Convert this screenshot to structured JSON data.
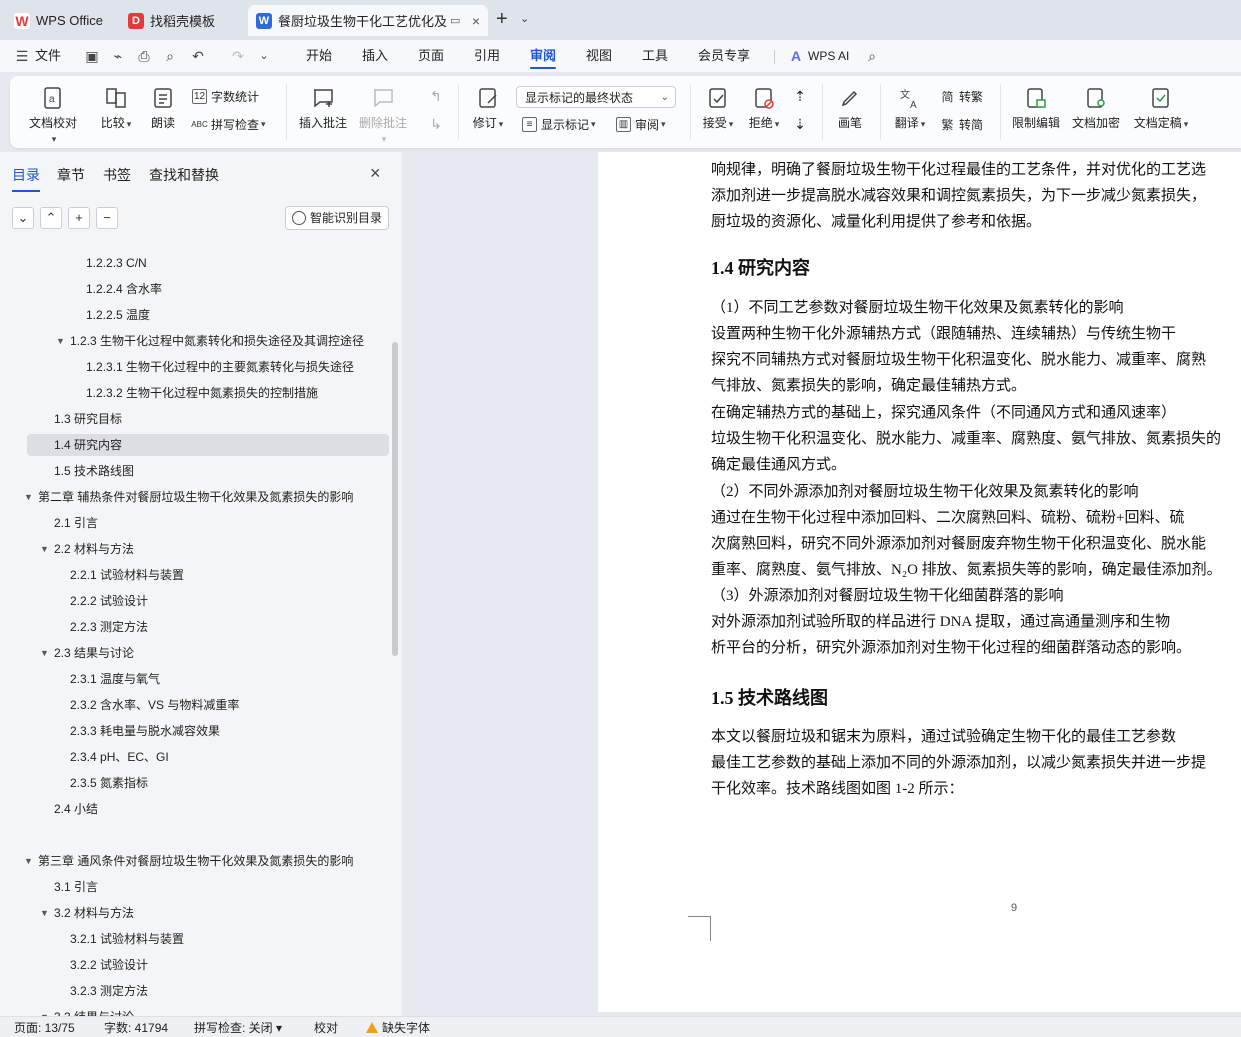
{
  "tabs": [
    {
      "label": "WPS Office"
    },
    {
      "label": "找稻壳模板"
    },
    {
      "label": "餐厨垃圾生物干化工艺优化及"
    }
  ],
  "menu": {
    "file": "文件",
    "items": [
      "开始",
      "插入",
      "页面",
      "引用",
      "审阅",
      "视图",
      "工具",
      "会员专享"
    ],
    "active": "审阅",
    "wps_ai": "WPS AI"
  },
  "ribbon": {
    "doc_check": "文档校对",
    "compare": "比较",
    "read_aloud": "朗读",
    "word_count": "字数统计",
    "spell_check": "拼写检查",
    "insert_comment": "插入批注",
    "delete_comment": "删除批注",
    "revise": "修订",
    "markup_state": "显示标记的最终状态",
    "show_markup": "显示标记",
    "review_pane": "审阅",
    "accept": "接受",
    "reject": "拒绝",
    "pen": "画笔",
    "translate": "翻译",
    "to_traditional": "转繁",
    "to_simplified": "转简",
    "restrict_edit": "限制编辑",
    "encrypt": "文档加密",
    "finalize": "文档定稿"
  },
  "sidebar": {
    "tabs": [
      "目录",
      "章节",
      "书签",
      "查找和替换"
    ],
    "smart_toc": "智能识别目录",
    "toc": [
      {
        "text": "1.2.2.3 C/N",
        "level": 4
      },
      {
        "text": "1.2.2.4 含水率",
        "level": 4
      },
      {
        "text": "1.2.2.5 温度",
        "level": 4
      },
      {
        "text": "1.2.3 生物干化过程中氮素转化和损失途径及其调控途径",
        "level": 3,
        "expanded": true
      },
      {
        "text": "1.2.3.1 生物干化过程中的主要氮素转化与损失途径",
        "level": 4
      },
      {
        "text": "1.2.3.2 生物干化过程中氮素损失的控制措施",
        "level": 4
      },
      {
        "text": "1.3 研究目标",
        "level": 2
      },
      {
        "text": "1.4 研究内容",
        "level": 2,
        "selected": true
      },
      {
        "text": "1.5 技术路线图",
        "level": 2
      },
      {
        "text": "第二章  辅热条件对餐厨垃圾生物干化效果及氮素损失的影响",
        "level": 1,
        "expanded": true
      },
      {
        "text": "2.1 引言",
        "level": 2
      },
      {
        "text": "2.2 材料与方法",
        "level": 2,
        "expanded": true
      },
      {
        "text": "2.2.1 试验材料与装置",
        "level": 3
      },
      {
        "text": "2.2.2 试验设计",
        "level": 3
      },
      {
        "text": "2.2.3 测定方法",
        "level": 3
      },
      {
        "text": "2.3 结果与讨论",
        "level": 2,
        "expanded": true
      },
      {
        "text": "2.3.1 温度与氧气",
        "level": 3
      },
      {
        "text": "2.3.2 含水率、VS 与物料减重率",
        "level": 3
      },
      {
        "text": "2.3.3 耗电量与脱水减容效果",
        "level": 3
      },
      {
        "text": "2.3.4 pH、EC、GI",
        "level": 3
      },
      {
        "text": "2.3.5 氮素指标",
        "level": 3
      },
      {
        "text": "2.4 小结",
        "level": 2
      },
      {
        "text": "",
        "level": 0
      },
      {
        "text": "第三章  通风条件对餐厨垃圾生物干化效果及氮素损失的影响",
        "level": 1,
        "expanded": true
      },
      {
        "text": "3.1 引言",
        "level": 2
      },
      {
        "text": "3.2 材料与方法",
        "level": 2,
        "expanded": true
      },
      {
        "text": "3.2.1 试验材料与装置",
        "level": 3
      },
      {
        "text": "3.2.2 试验设计",
        "level": 3
      },
      {
        "text": "3.2.3 测定方法",
        "level": 3
      },
      {
        "text": "3.3 结果与讨论",
        "level": 2,
        "expanded": true
      }
    ]
  },
  "document": {
    "lines": [
      {
        "t": "响规律，明确了餐厨垃圾生物干化过程最佳的工艺条件，并对优化的工艺选",
        "kind": "body"
      },
      {
        "t": "添加剂进一步提高脱水减容效果和调控氮素损失，为下一步减少氮素损失，",
        "kind": "body"
      },
      {
        "t": "厨垃圾的资源化、减量化利用提供了参考和依据。",
        "kind": "body"
      },
      {
        "t": "1.4 研究内容",
        "kind": "heading"
      },
      {
        "t": "（1）不同工艺参数对餐厨垃圾生物干化效果及氮素转化的影响",
        "kind": "body"
      },
      {
        "t": "        设置两种生物干化外源辅热方式（跟随辅热、连续辅热）与传统生物干",
        "kind": "body"
      },
      {
        "t": "探究不同辅热方式对餐厨垃圾生物干化积温变化、脱水能力、减重率、腐熟",
        "kind": "body"
      },
      {
        "t": "气排放、氮素损失的影响，确定最佳辅热方式。",
        "kind": "body"
      },
      {
        "t": "        在确定辅热方式的基础上，探究通风条件（不同通风方式和通风速率）",
        "kind": "body"
      },
      {
        "t": "垃圾生物干化积温变化、脱水能力、减重率、腐熟度、氨气排放、氮素损失的",
        "kind": "body"
      },
      {
        "t": "确定最佳通风方式。",
        "kind": "body"
      },
      {
        "t": "（2）不同外源添加剂对餐厨垃圾生物干化效果及氮素转化的影响",
        "kind": "body"
      },
      {
        "t": "        通过在生物干化过程中添加回料、二次腐熟回料、硫粉、硫粉+回料、硫",
        "kind": "body"
      },
      {
        "t": "次腐熟回料，研究不同外源添加剂对餐厨废弃物生物干化积温变化、脱水能",
        "kind": "body"
      },
      {
        "t": "重率、腐熟度、氨气排放、N₂O 排放、氮素损失等的影响，确定最佳添加剂。",
        "kind": "body"
      },
      {
        "t": "（3）外源添加剂对餐厨垃圾生物干化细菌群落的影响",
        "kind": "body"
      },
      {
        "t": "        对外源添加剂试验所取的样品进行 DNA 提取，通过高通量测序和生物",
        "kind": "body"
      },
      {
        "t": "析平台的分析，研究外源添加剂对生物干化过程的细菌群落动态的影响。",
        "kind": "body"
      },
      {
        "t": "1.5 技术路线图",
        "kind": "heading"
      },
      {
        "t": "        本文以餐厨垃圾和锯末为原料，通过试验确定生物干化的最佳工艺参数",
        "kind": "body"
      },
      {
        "t": "最佳工艺参数的基础上添加不同的外源添加剂，以减少氮素损失并进一步提",
        "kind": "body"
      },
      {
        "t": "干化效率。技术路线图如图 1-2 所示：",
        "kind": "body"
      }
    ],
    "page_number": "9"
  },
  "status": {
    "page": "页面: 13/75",
    "words": "字数: 41794",
    "spell": "拼写检查: 关闭",
    "proof": "校对",
    "missing_font": "缺失字体"
  },
  "colors": {
    "accent": "#1f56d8",
    "wps_red": "#e33b3b"
  }
}
